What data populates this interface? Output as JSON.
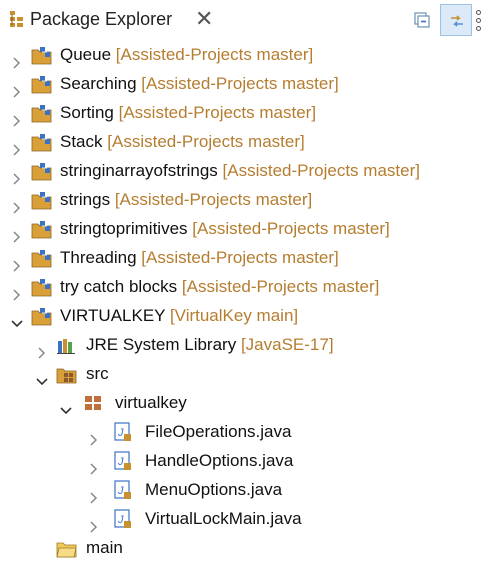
{
  "view": {
    "title": "Package Explorer",
    "close_glyph": "✕",
    "toolbar": [
      "collapse-all-icon",
      "link-with-editor-icon",
      "view-menu-icon"
    ]
  },
  "colors": {
    "decoration": "#b57d2f",
    "project_folder": "#d9a03a",
    "java_file": "#3b72c4",
    "selected_toggle_bg": "#dbe9f8"
  },
  "tree": {
    "projects": [
      {
        "name": "Queue",
        "decoration": "[Assisted-Projects master]"
      },
      {
        "name": "Searching",
        "decoration": "[Assisted-Projects master]"
      },
      {
        "name": "Sorting",
        "decoration": "[Assisted-Projects master]"
      },
      {
        "name": "Stack",
        "decoration": "[Assisted-Projects master]"
      },
      {
        "name": "stringinarrayofstrings",
        "decoration": "[Assisted-Projects master]"
      },
      {
        "name": "strings",
        "decoration": "[Assisted-Projects master]"
      },
      {
        "name": "stringtoprimitives",
        "decoration": "[Assisted-Projects master]"
      },
      {
        "name": "Threading",
        "decoration": "[Assisted-Projects master]"
      },
      {
        "name": "try catch blocks",
        "decoration": "[Assisted-Projects master]"
      }
    ],
    "open_project": {
      "name": "VIRTUALKEY",
      "decoration": "[VirtualKey main]",
      "jre": {
        "name": "JRE System Library",
        "decoration": "[JavaSE-17]"
      },
      "src": {
        "name": "src",
        "package": {
          "name": "virtualkey",
          "files": [
            "FileOperations.java",
            "HandleOptions.java",
            "MenuOptions.java",
            "VirtualLockMain.java"
          ]
        }
      },
      "main": {
        "name": "main"
      }
    }
  }
}
